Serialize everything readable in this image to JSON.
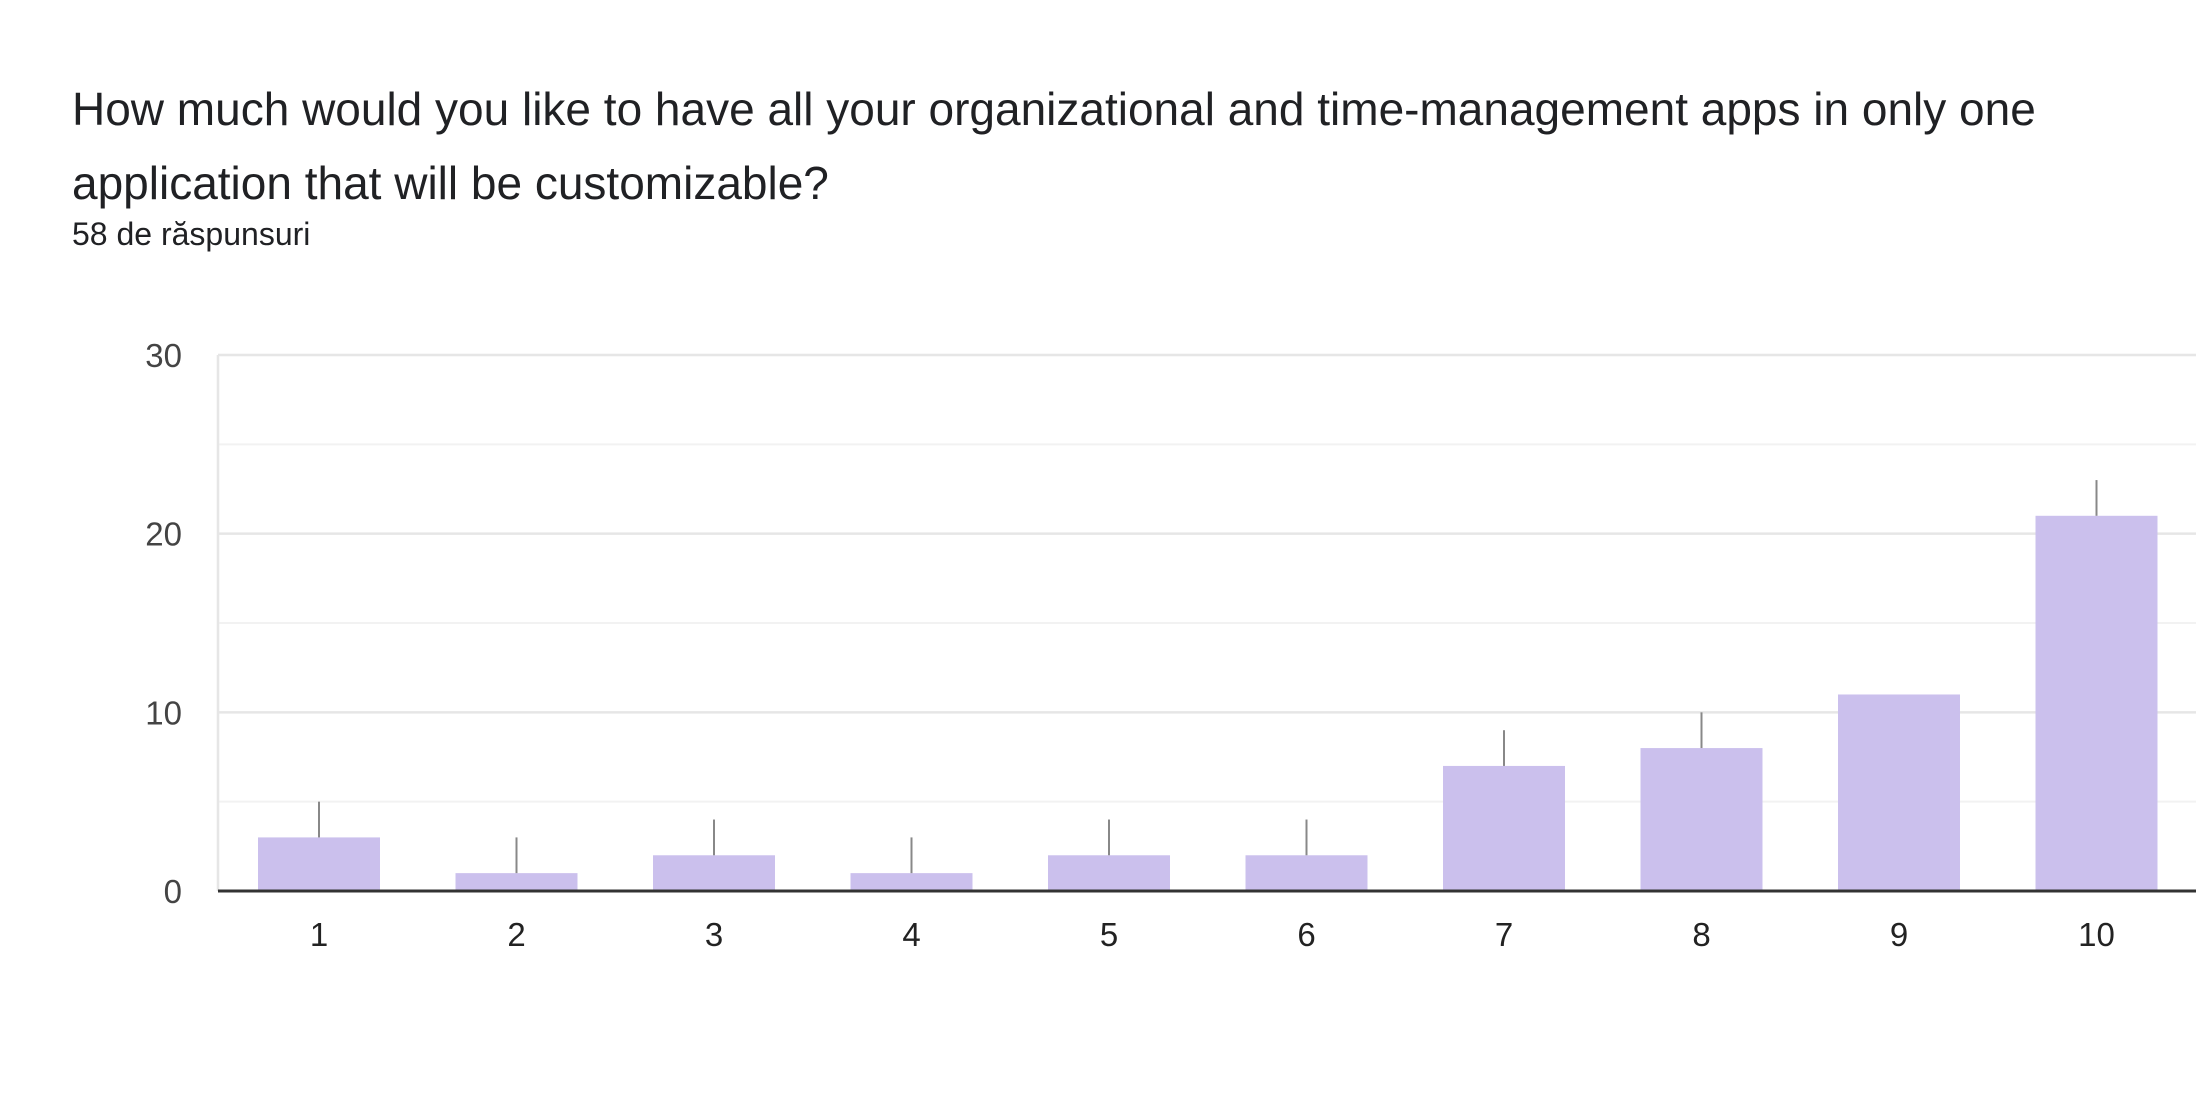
{
  "question": {
    "title": "How much would you like to have all your organizational and time-management apps in only one application that will be customizable?",
    "response_count": "58 de răspunsuri"
  },
  "colors": {
    "bar": "#cbc0ed",
    "grid_major": "#e6e6e6",
    "grid_minor": "#f2f2f2",
    "axis": "#333333",
    "whisker": "#888888"
  },
  "chart_data": {
    "type": "bar",
    "title": "How much would you like to have all your organizational and time-management apps in only one application that will be customizable?",
    "categories": [
      "1",
      "2",
      "3",
      "4",
      "5",
      "6",
      "7",
      "8",
      "9",
      "10"
    ],
    "values": [
      3,
      1,
      2,
      1,
      2,
      2,
      7,
      8,
      11,
      21
    ],
    "whisker_tops": [
      5,
      3,
      4,
      3,
      4,
      4,
      9,
      10,
      null,
      23
    ],
    "ylim": [
      0,
      30
    ],
    "yticks": [
      0,
      10,
      20,
      30
    ],
    "grid": true,
    "legend": "none"
  }
}
